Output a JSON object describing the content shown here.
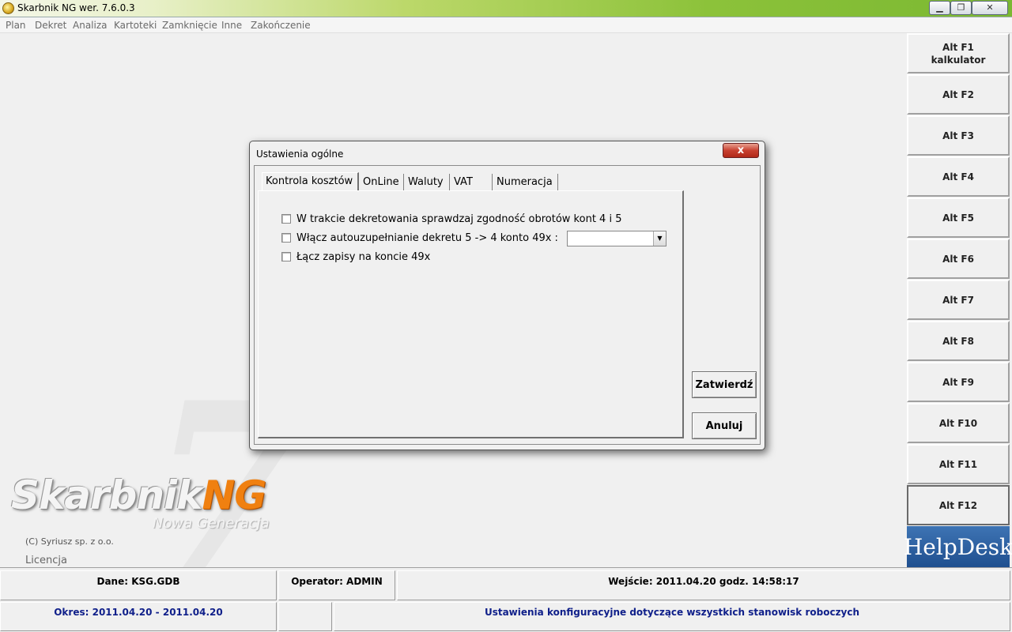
{
  "window": {
    "title": "Skarbnik NG wer. 7.6.0.3",
    "min_icon": "minimize-icon",
    "max_icon": "maximize-icon",
    "close_icon": "close-icon"
  },
  "menu": {
    "items": [
      "Plan",
      "Dekret",
      "Analiza",
      "Kartoteki",
      "Zamknięcie",
      "Inne",
      "Zakończenie"
    ]
  },
  "background": {
    "logo_main": "Skarbnik",
    "logo_accent": "NG",
    "logo_sub": "Nowa Generacja",
    "copyright": "(C) Syriusz sp. z o.o.",
    "licence": "Licencja",
    "big_digit": "7"
  },
  "fkeys": [
    {
      "line1": "Alt F1",
      "line2": "kalkulator"
    },
    {
      "line1": "Alt F2",
      "line2": ""
    },
    {
      "line1": "Alt F3",
      "line2": ""
    },
    {
      "line1": "Alt F4",
      "line2": ""
    },
    {
      "line1": "Alt F5",
      "line2": ""
    },
    {
      "line1": "Alt F6",
      "line2": ""
    },
    {
      "line1": "Alt F7",
      "line2": ""
    },
    {
      "line1": "Alt F8",
      "line2": ""
    },
    {
      "line1": "Alt F9",
      "line2": ""
    },
    {
      "line1": "Alt F10",
      "line2": ""
    },
    {
      "line1": "Alt F11",
      "line2": ""
    },
    {
      "line1": "Alt F12",
      "line2": ""
    }
  ],
  "helpdesk": "HelpDesk",
  "dialog": {
    "title": "Ustawienia ogólne",
    "close_symbol": "x",
    "tabs": [
      "Kontrola kosztów",
      "OnLine",
      "Waluty",
      "VAT",
      "Numeracja"
    ],
    "active_tab": "Kontrola kosztów",
    "options": [
      {
        "label": "W trakcie dekretowania sprawdzaj zgodność obrotów kont 4 i 5",
        "checked": false
      },
      {
        "label": "Włącz autouzupełnianie dekretu 5 -> 4  konto 49x :",
        "checked": false
      },
      {
        "label": "Łącz zapisy na koncie 49x",
        "checked": false
      }
    ],
    "combo_value": "",
    "combo_arrow": "▼",
    "buttons": {
      "confirm": "Zatwierdź",
      "cancel": "Anuluj"
    }
  },
  "status": {
    "dane": "Dane: KSG.GDB",
    "operator": "Operator: ADMIN",
    "wejscie": "Wejście: 2011.04.20 godz. 14:58:17",
    "okres": "Okres: 2011.04.20 - 2011.04.20",
    "opis": "Ustawienia konfiguracyjne dotyczące wszystkich stanowisk roboczych"
  }
}
